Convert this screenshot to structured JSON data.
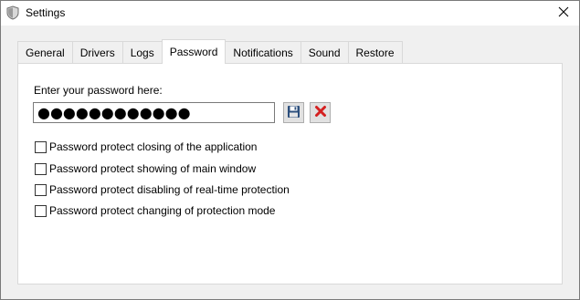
{
  "window": {
    "title": "Settings",
    "app_icon": "shield-icon",
    "close_icon": "close-icon"
  },
  "tabs": [
    {
      "label": "General",
      "active": false
    },
    {
      "label": "Drivers",
      "active": false
    },
    {
      "label": "Logs",
      "active": false
    },
    {
      "label": "Password",
      "active": true
    },
    {
      "label": "Notifications",
      "active": false
    },
    {
      "label": "Sound",
      "active": false
    },
    {
      "label": "Restore",
      "active": false
    }
  ],
  "password": {
    "label": "Enter your password here:",
    "value": "●●●●●●●●●●●●",
    "save_icon": "save-icon",
    "clear_icon": "clear-icon"
  },
  "options": [
    {
      "label": "Password protect closing of the application",
      "checked": false
    },
    {
      "label": "Password protect showing of main window",
      "checked": false
    },
    {
      "label": "Password protect disabling of real-time protection",
      "checked": false
    },
    {
      "label": "Password protect changing of protection mode",
      "checked": false
    }
  ],
  "colors": {
    "clear_red": "#d42020",
    "save_blue": "#2c4f7c"
  }
}
